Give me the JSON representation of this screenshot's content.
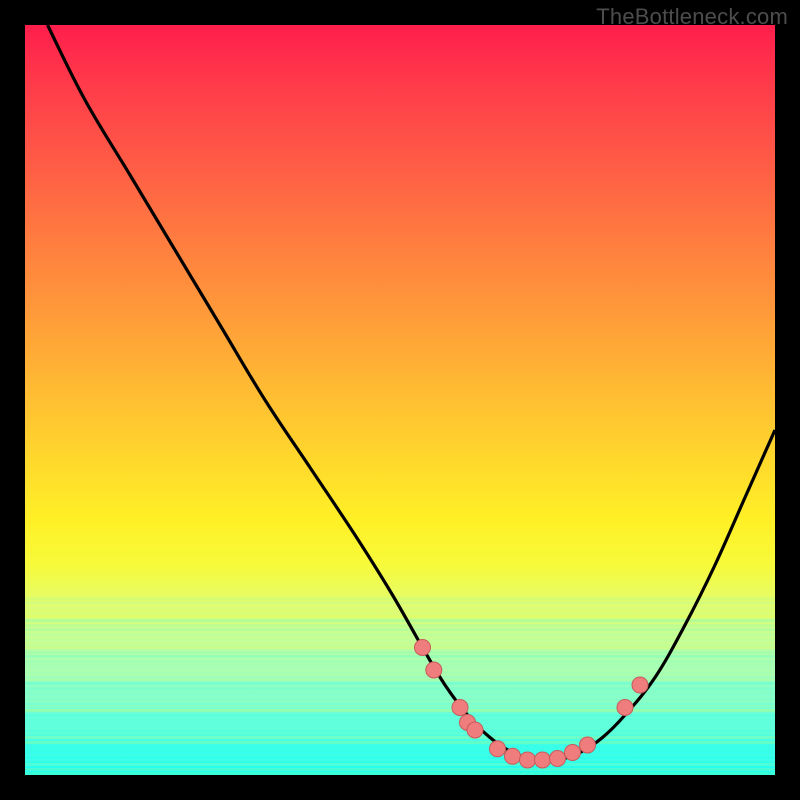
{
  "watermark": "TheBottleneck.com",
  "colors": {
    "frame": "#000000",
    "curve_stroke": "#000000",
    "marker_fill": "#ef7d7d",
    "marker_stroke": "#c95a5a"
  },
  "chart_data": {
    "type": "line",
    "title": "",
    "xlabel": "",
    "ylabel": "",
    "xlim": [
      0,
      100
    ],
    "ylim": [
      0,
      100
    ],
    "grid": false,
    "series": [
      {
        "name": "bottleneck-curve",
        "x": [
          3,
          8,
          14,
          20,
          26,
          32,
          38,
          44,
          49,
          53,
          56,
          59,
          62,
          65,
          68,
          71,
          74,
          77,
          80,
          84,
          88,
          92,
          96,
          100
        ],
        "y": [
          100,
          90,
          80,
          70,
          60,
          50,
          41,
          32,
          24,
          17,
          12,
          8,
          5,
          3,
          2,
          2,
          3,
          5,
          8,
          13,
          20,
          28,
          37,
          46
        ]
      }
    ],
    "markers": [
      {
        "x": 53,
        "y": 17
      },
      {
        "x": 54.5,
        "y": 14
      },
      {
        "x": 58,
        "y": 9
      },
      {
        "x": 59,
        "y": 7
      },
      {
        "x": 60,
        "y": 6
      },
      {
        "x": 63,
        "y": 3.5
      },
      {
        "x": 65,
        "y": 2.5
      },
      {
        "x": 67,
        "y": 2
      },
      {
        "x": 69,
        "y": 2
      },
      {
        "x": 71,
        "y": 2.2
      },
      {
        "x": 73,
        "y": 3
      },
      {
        "x": 75,
        "y": 4
      },
      {
        "x": 80,
        "y": 9
      },
      {
        "x": 82,
        "y": 12
      }
    ]
  }
}
